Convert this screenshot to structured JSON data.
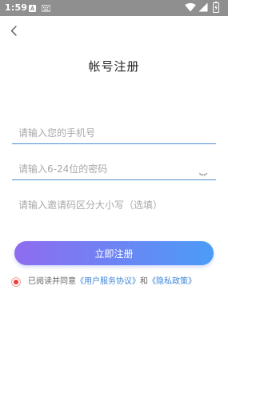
{
  "status_bar": {
    "time": "1:59"
  },
  "header": {
    "title": "帐号注册"
  },
  "form": {
    "phone_placeholder": "请输入您的手机号",
    "password_placeholder": "请输入6-24位的密码",
    "invite_placeholder": "请输入邀请码区分大小写（选填）",
    "register_label": "立即注册"
  },
  "agreement": {
    "prefix": "已阅读并同意",
    "user_agreement": "《用户服务协议》",
    "and": "和",
    "privacy_policy": "《隐私政策》",
    "checked": true
  },
  "colors": {
    "status_bar_bg": "#8f8f8f",
    "field_line": "#4c8ed4",
    "button_gradient_start": "#8f6cf0",
    "button_gradient_end": "#4b9cf7",
    "link": "#3f87d8",
    "radio_checked": "#ec3b3b"
  },
  "icons": {
    "back": "chevron-left-icon",
    "password_visibility": "eye-closed-icon",
    "wifi": "wifi-icon",
    "signal": "signal-icon",
    "battery": "battery-charging-icon"
  }
}
